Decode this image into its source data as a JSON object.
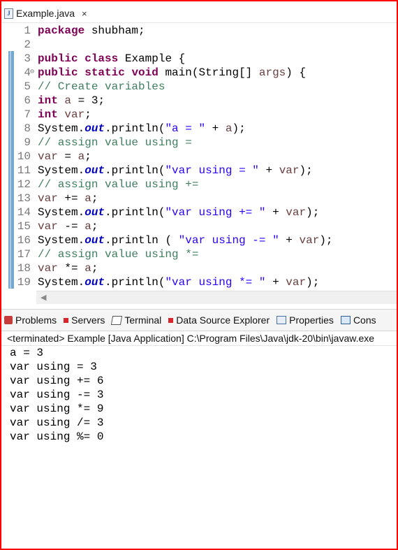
{
  "editor": {
    "tab": {
      "label": "Example.java",
      "icon": "java-file-icon",
      "close": "×"
    },
    "lines": [
      {
        "num": "1",
        "tokens": [
          [
            "kw",
            "package"
          ],
          [
            "p",
            " shubham;"
          ]
        ]
      },
      {
        "num": "2",
        "tokens": []
      },
      {
        "num": "3",
        "tokens": [
          [
            "kw",
            "public"
          ],
          [
            "p",
            " "
          ],
          [
            "kw",
            "class"
          ],
          [
            "p",
            " Example {"
          ]
        ]
      },
      {
        "num": "4",
        "fold": "⊖",
        "tokens": [
          [
            "kw",
            "public"
          ],
          [
            "p",
            " "
          ],
          [
            "kw",
            "static"
          ],
          [
            "p",
            " "
          ],
          [
            "kw",
            "void"
          ],
          [
            "p",
            " main(String[] "
          ],
          [
            "var",
            "args"
          ],
          [
            "p",
            ") {"
          ]
        ]
      },
      {
        "num": "5",
        "tokens": [
          [
            "cm",
            "// Create variables"
          ]
        ]
      },
      {
        "num": "6",
        "tokens": [
          [
            "kw",
            "int"
          ],
          [
            "p",
            " "
          ],
          [
            "var",
            "a"
          ],
          [
            "p",
            " = 3;"
          ]
        ]
      },
      {
        "num": "7",
        "tokens": [
          [
            "kw",
            "int"
          ],
          [
            "p",
            " "
          ],
          [
            "var",
            "var"
          ],
          [
            "p",
            ";"
          ]
        ]
      },
      {
        "num": "8",
        "tokens": [
          [
            "p",
            "System."
          ],
          [
            "fld",
            "out"
          ],
          [
            "p",
            ".println("
          ],
          [
            "st",
            "\"a = \""
          ],
          [
            "p",
            " + "
          ],
          [
            "var",
            "a"
          ],
          [
            "p",
            ");"
          ]
        ]
      },
      {
        "num": "9",
        "tokens": [
          [
            "cm",
            "// assign value using ="
          ]
        ]
      },
      {
        "num": "10",
        "tokens": [
          [
            "var",
            "var"
          ],
          [
            "p",
            " = "
          ],
          [
            "var",
            "a"
          ],
          [
            "p",
            ";"
          ]
        ]
      },
      {
        "num": "11",
        "tokens": [
          [
            "p",
            "System."
          ],
          [
            "fld",
            "out"
          ],
          [
            "p",
            ".println("
          ],
          [
            "st",
            "\"var using = \""
          ],
          [
            "p",
            " + "
          ],
          [
            "var",
            "var"
          ],
          [
            "p",
            ");"
          ]
        ]
      },
      {
        "num": "12",
        "tokens": [
          [
            "cm",
            "// assign value using +="
          ]
        ]
      },
      {
        "num": "13",
        "tokens": [
          [
            "var",
            "var"
          ],
          [
            "p",
            " += "
          ],
          [
            "var",
            "a"
          ],
          [
            "p",
            ";"
          ]
        ]
      },
      {
        "num": "14",
        "tokens": [
          [
            "p",
            "System."
          ],
          [
            "fld",
            "out"
          ],
          [
            "p",
            ".println("
          ],
          [
            "st",
            "\"var using += \""
          ],
          [
            "p",
            " + "
          ],
          [
            "var",
            "var"
          ],
          [
            "p",
            ");"
          ]
        ]
      },
      {
        "num": "15",
        "tokens": [
          [
            "var",
            "var"
          ],
          [
            "p",
            " -= "
          ],
          [
            "var",
            "a"
          ],
          [
            "p",
            ";"
          ]
        ]
      },
      {
        "num": "16",
        "tokens": [
          [
            "p",
            "System."
          ],
          [
            "fld",
            "out"
          ],
          [
            "p",
            ".println ( "
          ],
          [
            "st",
            "\"var using -= \""
          ],
          [
            "p",
            " + "
          ],
          [
            "var",
            "var"
          ],
          [
            "p",
            ");"
          ]
        ]
      },
      {
        "num": "17",
        "tokens": [
          [
            "cm",
            "// assign value using *="
          ]
        ]
      },
      {
        "num": "18",
        "tokens": [
          [
            "var",
            "var"
          ],
          [
            "p",
            " *= "
          ],
          [
            "var",
            "a"
          ],
          [
            "p",
            ";"
          ]
        ]
      },
      {
        "num": "19",
        "tokens": [
          [
            "p",
            "System."
          ],
          [
            "fld",
            "out"
          ],
          [
            "p",
            ".println("
          ],
          [
            "st",
            "\"var using *= \""
          ],
          [
            "p",
            " + "
          ],
          [
            "var",
            "var"
          ],
          [
            "p",
            ");"
          ]
        ]
      }
    ],
    "scroll_left_arrow": "◀"
  },
  "views": {
    "tabs": [
      {
        "label": "Problems",
        "icon": "problems-icon"
      },
      {
        "label": "Servers",
        "icon": "servers-icon"
      },
      {
        "label": "Terminal",
        "icon": "terminal-icon"
      },
      {
        "label": "Data Source Explorer",
        "icon": "data-source-icon"
      },
      {
        "label": "Properties",
        "icon": "properties-icon"
      },
      {
        "label": "Cons",
        "icon": "console-icon"
      }
    ]
  },
  "console": {
    "header": "<terminated> Example [Java Application] C:\\Program Files\\Java\\jdk-20\\bin\\javaw.exe",
    "output": [
      "a = 3",
      "var using = 3",
      "var using += 6",
      "var using -= 3",
      "var using *= 9",
      "var using /= 3",
      "var using %= 0"
    ]
  },
  "colors": {
    "frame_border": "#ff0000",
    "keyword": "#7f0055",
    "comment": "#3f7f5f",
    "string": "#2a00ff",
    "field": "#0000c0",
    "local_var": "#6a3e3e",
    "change_bar": "#5d99c6"
  }
}
